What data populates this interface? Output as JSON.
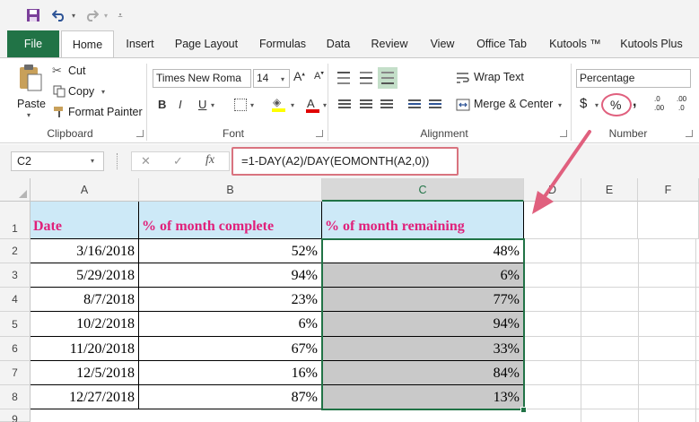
{
  "ribbon_tabs": [
    "File",
    "Home",
    "Insert",
    "Page Layout",
    "Formulas",
    "Data",
    "Review",
    "View",
    "Office Tab",
    "Kutools ™",
    "Kutools Plus"
  ],
  "clipboard": {
    "paste": "Paste",
    "cut": "Cut",
    "copy": "Copy",
    "format_painter": "Format Painter",
    "group_label": "Clipboard"
  },
  "font": {
    "font_name": "Times New Roma",
    "font_size": "14",
    "bold": "B",
    "italic": "I",
    "underline": "U",
    "font_color": "A",
    "group_label": "Font"
  },
  "alignment": {
    "wrap_text": "Wrap Text",
    "merge_center": "Merge & Center",
    "group_label": "Alignment"
  },
  "number": {
    "format": "Percentage",
    "currency": "$",
    "percent": "%",
    "comma": ",",
    "increase_decimal": ".00",
    "decrease_decimal": ".0",
    "group_label": "Number"
  },
  "formula_bar": {
    "name_box": "C2",
    "cancel": "✕",
    "enter": "✓",
    "fx": "fx",
    "formula": "=1-DAY(A2)/DAY(EOMONTH(A2,0))"
  },
  "sheet": {
    "columns": [
      "A",
      "B",
      "C",
      "D",
      "E",
      "F"
    ],
    "rows": [
      "1",
      "2",
      "3",
      "4",
      "5",
      "6",
      "7",
      "8",
      "9"
    ],
    "headers": [
      "Date",
      "% of month complete",
      "% of month remaining"
    ],
    "data": [
      {
        "date": "3/16/2018",
        "complete": "52%",
        "remaining": "48%"
      },
      {
        "date": "5/29/2018",
        "complete": "94%",
        "remaining": "6%"
      },
      {
        "date": "8/7/2018",
        "complete": "23%",
        "remaining": "77%"
      },
      {
        "date": "10/2/2018",
        "complete": "6%",
        "remaining": "94%"
      },
      {
        "date": "11/20/2018",
        "complete": "67%",
        "remaining": "33%"
      },
      {
        "date": "12/5/2018",
        "complete": "16%",
        "remaining": "84%"
      },
      {
        "date": "12/27/2018",
        "complete": "87%",
        "remaining": "13%"
      }
    ]
  },
  "colors": {
    "excel_green": "#217346",
    "header_fill": "#cde9f7",
    "header_text": "#e0207a",
    "selected_fill": "#c9c9c9",
    "annotation": "#e0607e"
  }
}
